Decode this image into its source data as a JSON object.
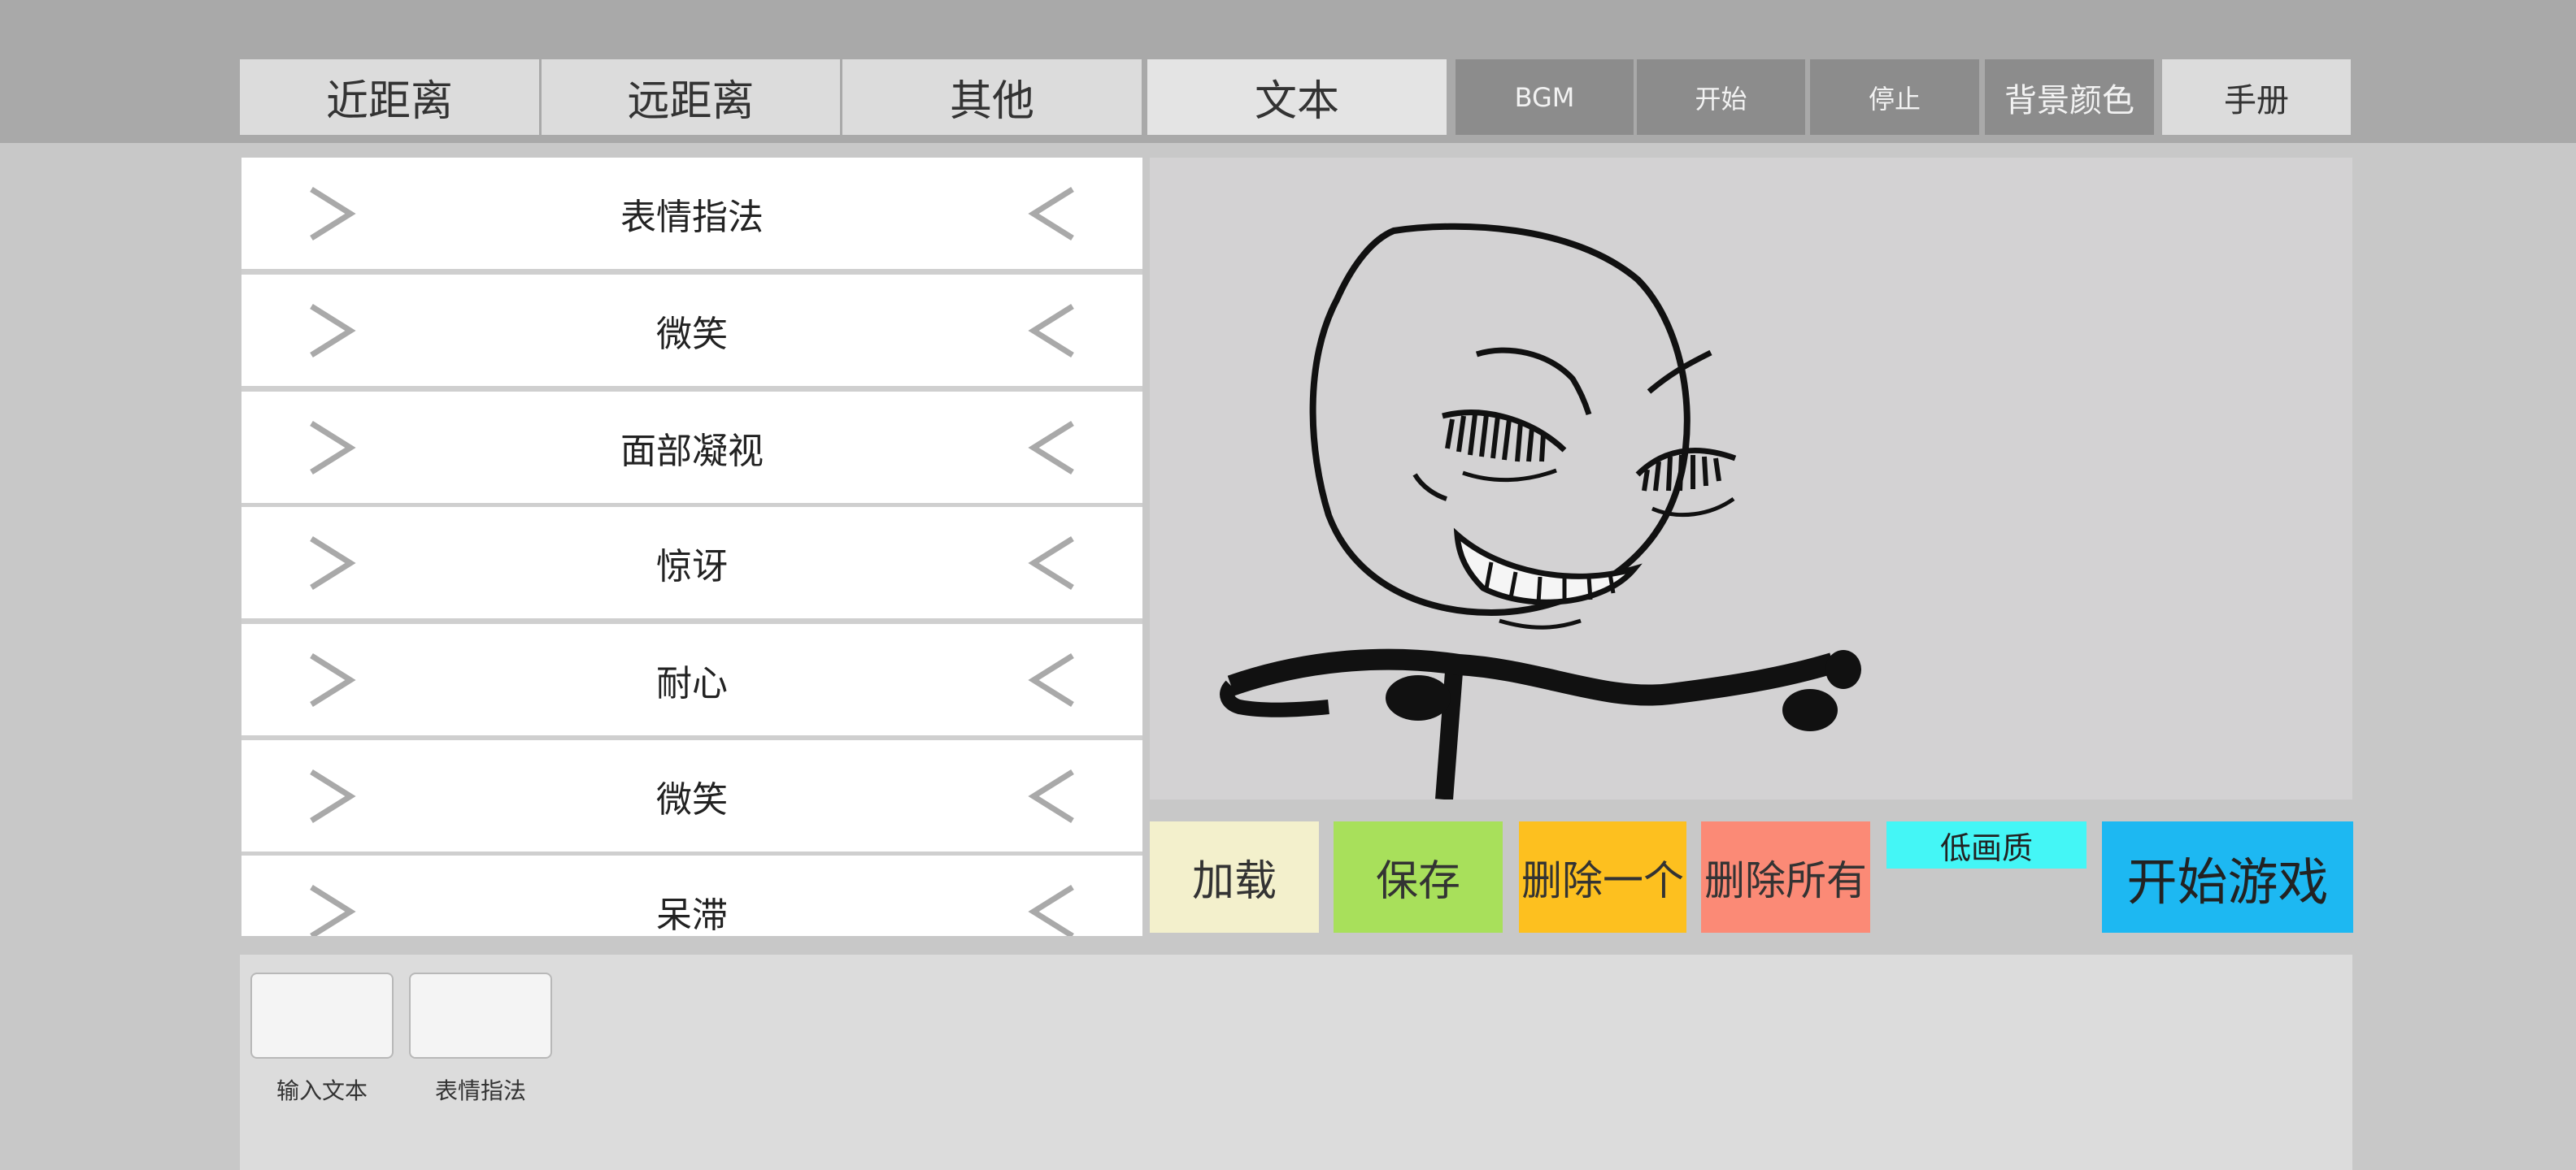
{
  "tabs": [
    {
      "label": "近距离"
    },
    {
      "label": "远距离"
    },
    {
      "label": "其他"
    },
    {
      "label": "文本"
    }
  ],
  "toolbar": {
    "bgm": "BGM",
    "start": "开始",
    "stop": "停止",
    "bg_color": "背景颜色",
    "manual": "手册"
  },
  "list": {
    "items": [
      {
        "label": "表情指法"
      },
      {
        "label": "微笑"
      },
      {
        "label": "面部凝视"
      },
      {
        "label": "惊讶"
      },
      {
        "label": "耐心"
      },
      {
        "label": "微笑"
      },
      {
        "label": "呆滞"
      }
    ]
  },
  "actions": {
    "load": "加载",
    "save": "保存",
    "delete_one": "删除一个",
    "delete_all": "删除所有",
    "low_quality": "低画质",
    "start_game": "开始游戏"
  },
  "bottom": {
    "slots": [
      {
        "label": "输入文本"
      },
      {
        "label": "表情指法"
      }
    ]
  },
  "colors": {
    "load": "#f3f0cc",
    "save": "#a8e05b",
    "delete_one": "#fdc01f",
    "delete_all": "#fb8a76",
    "low_quality": "#44f6f6",
    "start_game": "#1db8f2"
  },
  "icons": {
    "row_left": "chevron-right-icon",
    "row_right": "chevron-left-icon"
  }
}
